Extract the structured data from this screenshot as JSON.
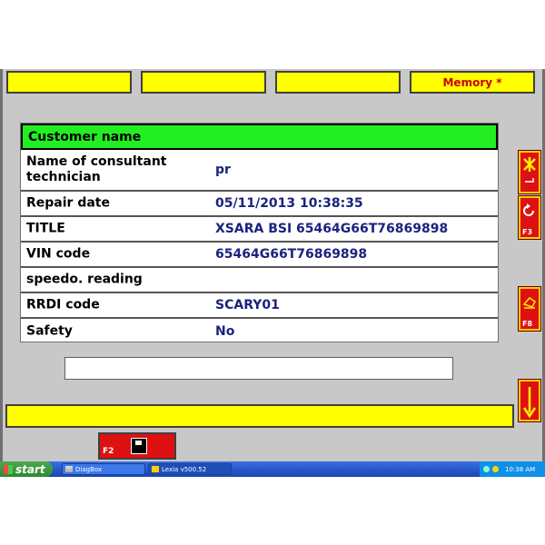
{
  "top_buttons": [
    {
      "label": ""
    },
    {
      "label": ""
    },
    {
      "label": ""
    },
    {
      "label": "Memory *"
    }
  ],
  "panel": {
    "header": "Customer name",
    "rows": [
      {
        "label": "Name of consultant technician",
        "value": "pr"
      },
      {
        "label": "Repair date",
        "value": "05/11/2013 10:38:35"
      },
      {
        "label": "TITLE",
        "value": "XSARA BSI 65464G66T76869898"
      },
      {
        "label": "VIN code",
        "value": "65464G66T76869898"
      },
      {
        "label": "speedo. reading",
        "value": ""
      },
      {
        "label": "RRDI code",
        "value": "SCARY01"
      },
      {
        "label": "Safety",
        "value": "No"
      }
    ]
  },
  "text_field": {
    "value": ""
  },
  "side_buttons": [
    {
      "icon": "exit-icon",
      "fkey": ""
    },
    {
      "icon": "refresh-icon",
      "fkey": "F3"
    },
    {
      "icon": "print-icon",
      "fkey": "F8"
    },
    {
      "icon": "arrow-down-icon",
      "fkey": ""
    }
  ],
  "save_button": {
    "fkey": "F2",
    "icon": "floppy-disk-icon"
  },
  "taskbar": {
    "start_label": "start",
    "items": [
      {
        "label": "DiagBox"
      },
      {
        "label": "Lexia v500.52"
      }
    ],
    "clock": "10:38 AM"
  },
  "colors": {
    "button_yellow": "#ffff00",
    "header_green": "#22ee22",
    "value_blue": "#1a237e",
    "accent_red": "#dd1111"
  }
}
